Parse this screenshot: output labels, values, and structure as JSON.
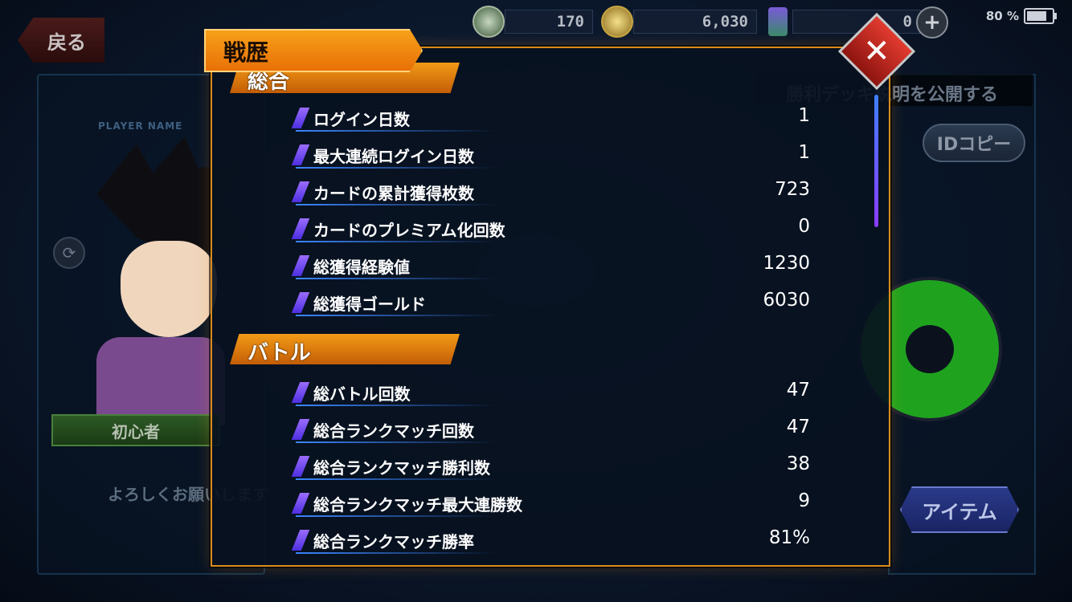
{
  "topbar": {
    "back_label": "戻る",
    "currency_1": "170",
    "currency_2": "6,030",
    "currency_3": "0",
    "add_label": "+",
    "battery": "80 %",
    "battery_level": 0.8
  },
  "background": {
    "player_name_label": "PLAYER NAME",
    "title_badge": "初心者",
    "greeting": "よろしくお願いします",
    "win_deck_publish": "勝利デッキ説明を公開する",
    "id_copy": "IDコピー",
    "item_button": "アイテム"
  },
  "modal": {
    "title": "戦歴",
    "close_symbol": "✕",
    "sections": [
      {
        "header": "総合",
        "rows": [
          {
            "label": "ログイン日数",
            "value": "1"
          },
          {
            "label": "最大連続ログイン日数",
            "value": "1"
          },
          {
            "label": "カードの累計獲得枚数",
            "value": "723"
          },
          {
            "label": "カードのプレミアム化回数",
            "value": "0"
          },
          {
            "label": "総獲得経験値",
            "value": "1230"
          },
          {
            "label": "総獲得ゴールド",
            "value": "6030"
          }
        ]
      },
      {
        "header": "バトル",
        "rows": [
          {
            "label": "総バトル回数",
            "value": "47"
          },
          {
            "label": "総合ランクマッチ回数",
            "value": "47"
          },
          {
            "label": "総合ランクマッチ勝利数",
            "value": "38"
          },
          {
            "label": "総合ランクマッチ最大連勝数",
            "value": "9"
          },
          {
            "label": "総合ランクマッチ勝率",
            "value": "81%"
          }
        ]
      }
    ]
  },
  "colors": {
    "accent_orange": "#e86f06",
    "frame_orange": "#d98a1a",
    "close_red": "#e23b2f",
    "scroll_blue": "#3f7fff"
  }
}
